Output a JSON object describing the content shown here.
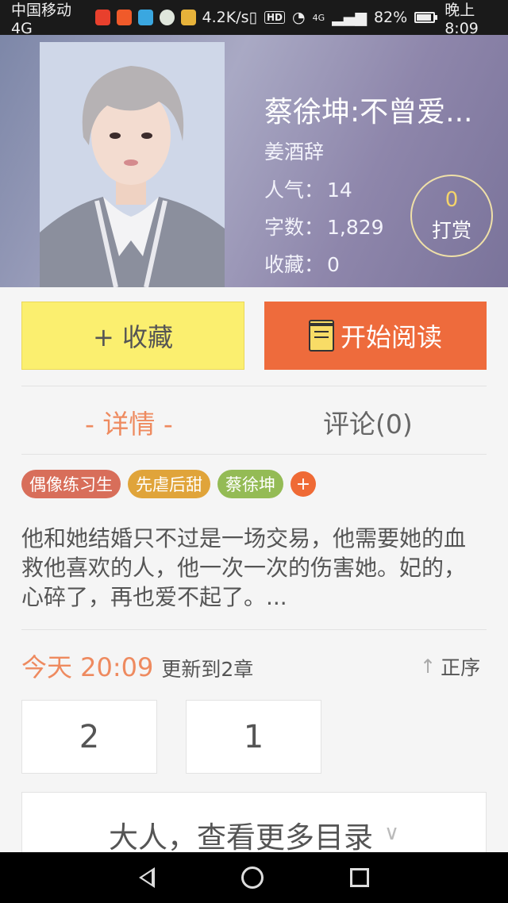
{
  "status_bar": {
    "carrier": "中国移动4G",
    "speed": "4.2K/s",
    "hd": "HD",
    "network": "4G",
    "battery": "82%",
    "time": "晚上8:09"
  },
  "book": {
    "title": "蔡徐坤:不曾爱...",
    "author": "姜酒辞",
    "stats": [
      {
        "label": "人气：",
        "value": "14"
      },
      {
        "label": "字数：",
        "value": "1,829"
      },
      {
        "label": "收藏：",
        "value": "0"
      }
    ],
    "tip": {
      "count": "0",
      "label": "打赏"
    }
  },
  "actions": {
    "favorite_label": "+ 收藏",
    "read_label": "开始阅读"
  },
  "tabs": [
    {
      "label": "- 详情 -",
      "active": true
    },
    {
      "label": "评论(0)",
      "active": false
    }
  ],
  "tags": [
    {
      "label": "偶像练习生",
      "color": "#d86e5a"
    },
    {
      "label": "先虐后甜",
      "color": "#e0a43a"
    },
    {
      "label": "蔡徐坤",
      "color": "#94bb55"
    }
  ],
  "tag_add": "+",
  "synopsis": "他和她结婚只不过是一场交易，他需要她的血救他喜欢的人，他一次一次的伤害她。妃的，心碎了，再也爱不起了。...",
  "update": {
    "time": "今天 20:09",
    "chapter": "更新到2章",
    "order": "正序"
  },
  "chapters": [
    "2",
    "1"
  ],
  "more_label": "大人，查看更多目录",
  "colors": {
    "accent": "#ee6b3c",
    "favorite_bg": "#fbef6f",
    "tab_active": "#ee8a5f"
  }
}
